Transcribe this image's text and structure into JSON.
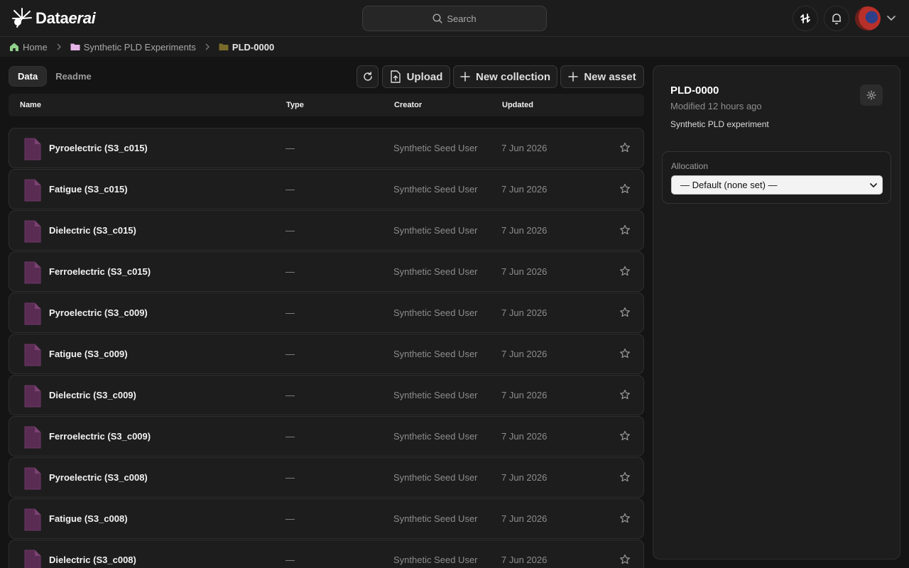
{
  "app": {
    "logo_text": "Data",
    "logo_text_italic": "erai"
  },
  "search": {
    "placeholder": "Search"
  },
  "breadcrumb": [
    {
      "label": "Home",
      "icon": "home-icon"
    },
    {
      "label": "Synthetic PLD Experiments",
      "icon": "folder-icon"
    },
    {
      "label": "PLD-0000",
      "icon": "folder-icon"
    }
  ],
  "tabs": [
    {
      "label": "Data",
      "active": true
    },
    {
      "label": "Readme",
      "active": false
    }
  ],
  "toolbar": {
    "upload_label": "Upload",
    "new_collection_label": "New collection",
    "new_asset_label": "New asset"
  },
  "table": {
    "columns": [
      "Name",
      "Type",
      "Creator",
      "Updated"
    ],
    "rows": [
      {
        "name": "Pyroelectric (S3_c015)",
        "type": "—",
        "creator": "Synthetic Seed User",
        "updated": "7 Jun 2026"
      },
      {
        "name": "Fatigue (S3_c015)",
        "type": "—",
        "creator": "Synthetic Seed User",
        "updated": "7 Jun 2026"
      },
      {
        "name": "Dielectric (S3_c015)",
        "type": "—",
        "creator": "Synthetic Seed User",
        "updated": "7 Jun 2026"
      },
      {
        "name": "Ferroelectric (S3_c015)",
        "type": "—",
        "creator": "Synthetic Seed User",
        "updated": "7 Jun 2026"
      },
      {
        "name": "Pyroelectric (S3_c009)",
        "type": "—",
        "creator": "Synthetic Seed User",
        "updated": "7 Jun 2026"
      },
      {
        "name": "Fatigue (S3_c009)",
        "type": "—",
        "creator": "Synthetic Seed User",
        "updated": "7 Jun 2026"
      },
      {
        "name": "Dielectric (S3_c009)",
        "type": "—",
        "creator": "Synthetic Seed User",
        "updated": "7 Jun 2026"
      },
      {
        "name": "Ferroelectric (S3_c009)",
        "type": "—",
        "creator": "Synthetic Seed User",
        "updated": "7 Jun 2026"
      },
      {
        "name": "Pyroelectric (S3_c008)",
        "type": "—",
        "creator": "Synthetic Seed User",
        "updated": "7 Jun 2026"
      },
      {
        "name": "Fatigue (S3_c008)",
        "type": "—",
        "creator": "Synthetic Seed User",
        "updated": "7 Jun 2026"
      },
      {
        "name": "Dielectric (S3_c008)",
        "type": "—",
        "creator": "Synthetic Seed User",
        "updated": "7 Jun 2026"
      }
    ]
  },
  "panel": {
    "title": "PLD-0000",
    "modified": "Modified 12 hours ago",
    "description": "Synthetic PLD experiment",
    "allocation_label": "Allocation",
    "allocation_value": "— Default (none set) —"
  },
  "colors": {
    "background": "#141414",
    "surface": "#1d1d1d",
    "file_icon": "#5a2c54",
    "home_icon": "#8fd18c",
    "folder_pink": "#e6b3e6",
    "folder_olive": "#7a6a2a"
  }
}
